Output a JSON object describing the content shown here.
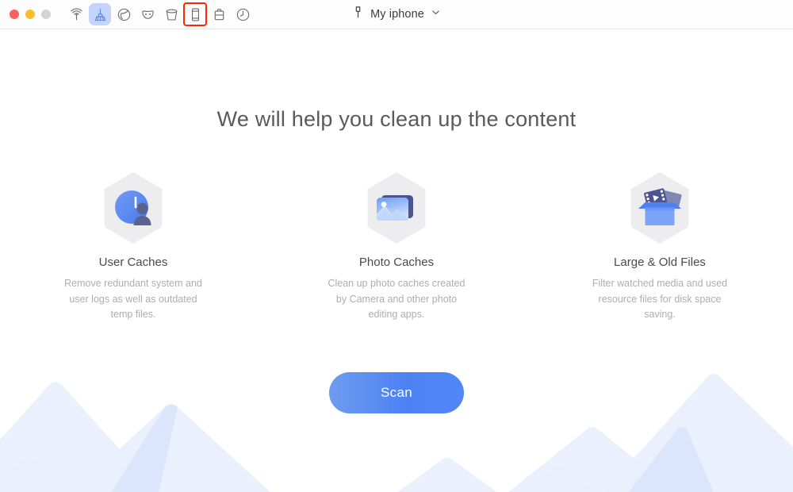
{
  "window": {
    "traffic_lights": [
      {
        "name": "close",
        "color": "#ff5f57"
      },
      {
        "name": "minimize",
        "color": "#febc2e"
      },
      {
        "name": "zoom",
        "color": "#d3d3d3"
      }
    ]
  },
  "toolbar": {
    "items": [
      {
        "icon": "wifi-signal-icon",
        "name": "status-monitor",
        "state": "normal"
      },
      {
        "icon": "broom-icon",
        "name": "cleaner",
        "state": "active"
      },
      {
        "icon": "circle-slash-icon",
        "name": "duplicate-finder",
        "state": "normal"
      },
      {
        "icon": "mask-icon",
        "name": "privacy",
        "state": "normal"
      },
      {
        "icon": "trash-bin-icon",
        "name": "uninstaller",
        "state": "normal"
      },
      {
        "icon": "phone-icon",
        "name": "device-cleaner",
        "state": "selected"
      },
      {
        "icon": "briefcase-icon",
        "name": "toolkit",
        "state": "normal"
      },
      {
        "icon": "clock-history-icon",
        "name": "history",
        "state": "normal"
      }
    ],
    "selection_outline_color": "#ff2600",
    "active_background_color": "#c5d4fb"
  },
  "device": {
    "icon": "usb-connector-icon",
    "name": "My iphone",
    "chevron": "chevron-down-icon"
  },
  "main": {
    "headline": "We will help you clean up the content",
    "features": [
      {
        "icon": "user-clock-hexagon-icon",
        "title": "User Caches",
        "description": "Remove redundant system and user logs as well as outdated temp files."
      },
      {
        "icon": "photo-hexagon-icon",
        "title": "Photo Caches",
        "description": "Clean up photo caches created by Camera and other photo editing apps."
      },
      {
        "icon": "media-box-hexagon-icon",
        "title": "Large & Old Files",
        "description": "Filter watched media and used resource files for disk space saving."
      }
    ],
    "scan_button": {
      "label": "Scan",
      "gradient_from": "#6f9cf0",
      "gradient_to": "#5186f5"
    }
  },
  "decoration": {
    "mountains_color_light": "#eaf0fc",
    "mountains_color_dark": "#d8e4fb"
  }
}
